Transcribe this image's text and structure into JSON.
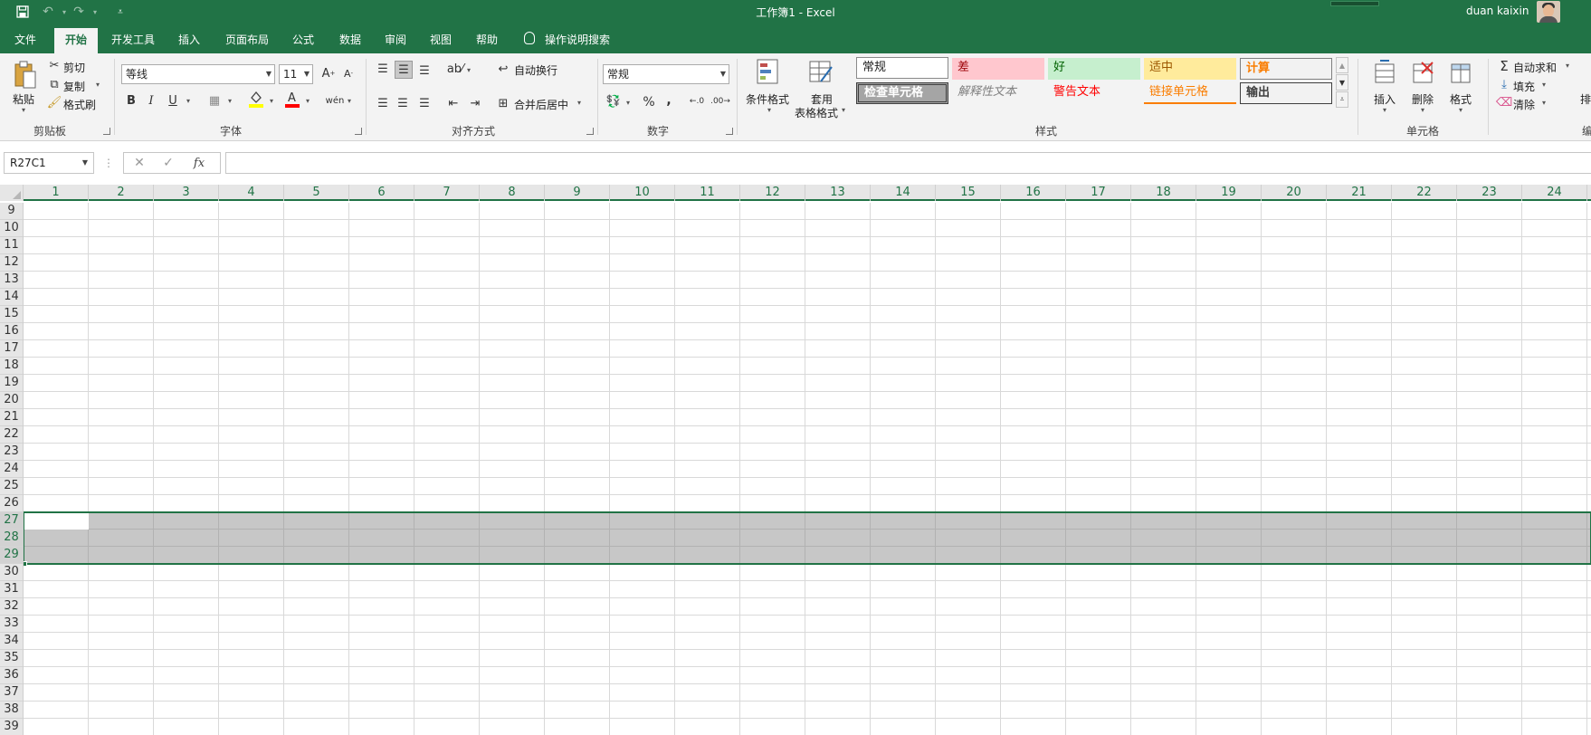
{
  "app": {
    "title": "工作簿1  -  Excel",
    "user": "duan kaixin"
  },
  "tabs": [
    "文件",
    "开始",
    "开发工具",
    "插入",
    "页面布局",
    "公式",
    "数据",
    "审阅",
    "视图",
    "帮助"
  ],
  "tell_me": "操作说明搜索",
  "ribbon": {
    "clipboard": {
      "label": "剪贴板",
      "paste": "粘贴",
      "cut": "剪切",
      "copy": "复制",
      "format_painter": "格式刷"
    },
    "font": {
      "label": "字体",
      "family": "等线",
      "size": "11"
    },
    "alignment": {
      "label": "对齐方式",
      "wrap_text": "自动换行",
      "merge_center": "合并后居中"
    },
    "number": {
      "label": "数字",
      "format": "常规"
    },
    "styles": {
      "label": "样式",
      "conditional": "条件格式",
      "table_format_1": "套用",
      "table_format_2": "表格格式",
      "cells": [
        {
          "text": "常规",
          "bg": "#ffffff",
          "fg": "#000000"
        },
        {
          "text": "差",
          "bg": "#ffc7ce",
          "fg": "#9c0006"
        },
        {
          "text": "好",
          "bg": "#c6efce",
          "fg": "#006100"
        },
        {
          "text": "适中",
          "bg": "#ffeb9c",
          "fg": "#9c5700"
        },
        {
          "text": "计算",
          "bg": "#f2f2f2",
          "fg": "#fa7d00"
        },
        {
          "text": "检查单元格",
          "bg": "#a5a5a5",
          "fg": "#ffffff"
        },
        {
          "text": "解释性文本",
          "bg": "#f3f3f3",
          "fg": "#7f7f7f"
        },
        {
          "text": "警告文本",
          "bg": "#f3f3f3",
          "fg": "#ff0000"
        },
        {
          "text": "链接单元格",
          "bg": "#f3f3f3",
          "fg": "#fa7d00"
        },
        {
          "text": "输出",
          "bg": "#f2f2f2",
          "fg": "#3f3f3f"
        }
      ]
    },
    "cells": {
      "label": "单元格",
      "insert": "插入",
      "delete": "删除",
      "format": "格式"
    },
    "editing": {
      "autosum": "自动求和",
      "fill": "填充",
      "clear": "清除",
      "sort_partial": "排",
      "label_partial": "编"
    }
  },
  "formula_bar": {
    "name_box": "R27C1",
    "formula": ""
  },
  "sheet": {
    "columns": [
      "1",
      "2",
      "3",
      "4",
      "5",
      "6",
      "7",
      "8",
      "9",
      "10",
      "11",
      "12",
      "13",
      "14",
      "15",
      "16",
      "17",
      "18",
      "19",
      "20",
      "21",
      "22",
      "23",
      "24"
    ],
    "rows": [
      "9",
      "10",
      "11",
      "12",
      "13",
      "14",
      "15",
      "16",
      "17",
      "18",
      "19",
      "20",
      "21",
      "22",
      "23",
      "24",
      "25",
      "26",
      "27",
      "28",
      "29",
      "30",
      "31",
      "32",
      "33",
      "34",
      "35",
      "36",
      "37",
      "38",
      "39"
    ],
    "selected_rows": [
      "27",
      "28",
      "29"
    ]
  },
  "colors": {
    "brand": "#217346",
    "ribbon_bg": "#f3f3f3"
  }
}
